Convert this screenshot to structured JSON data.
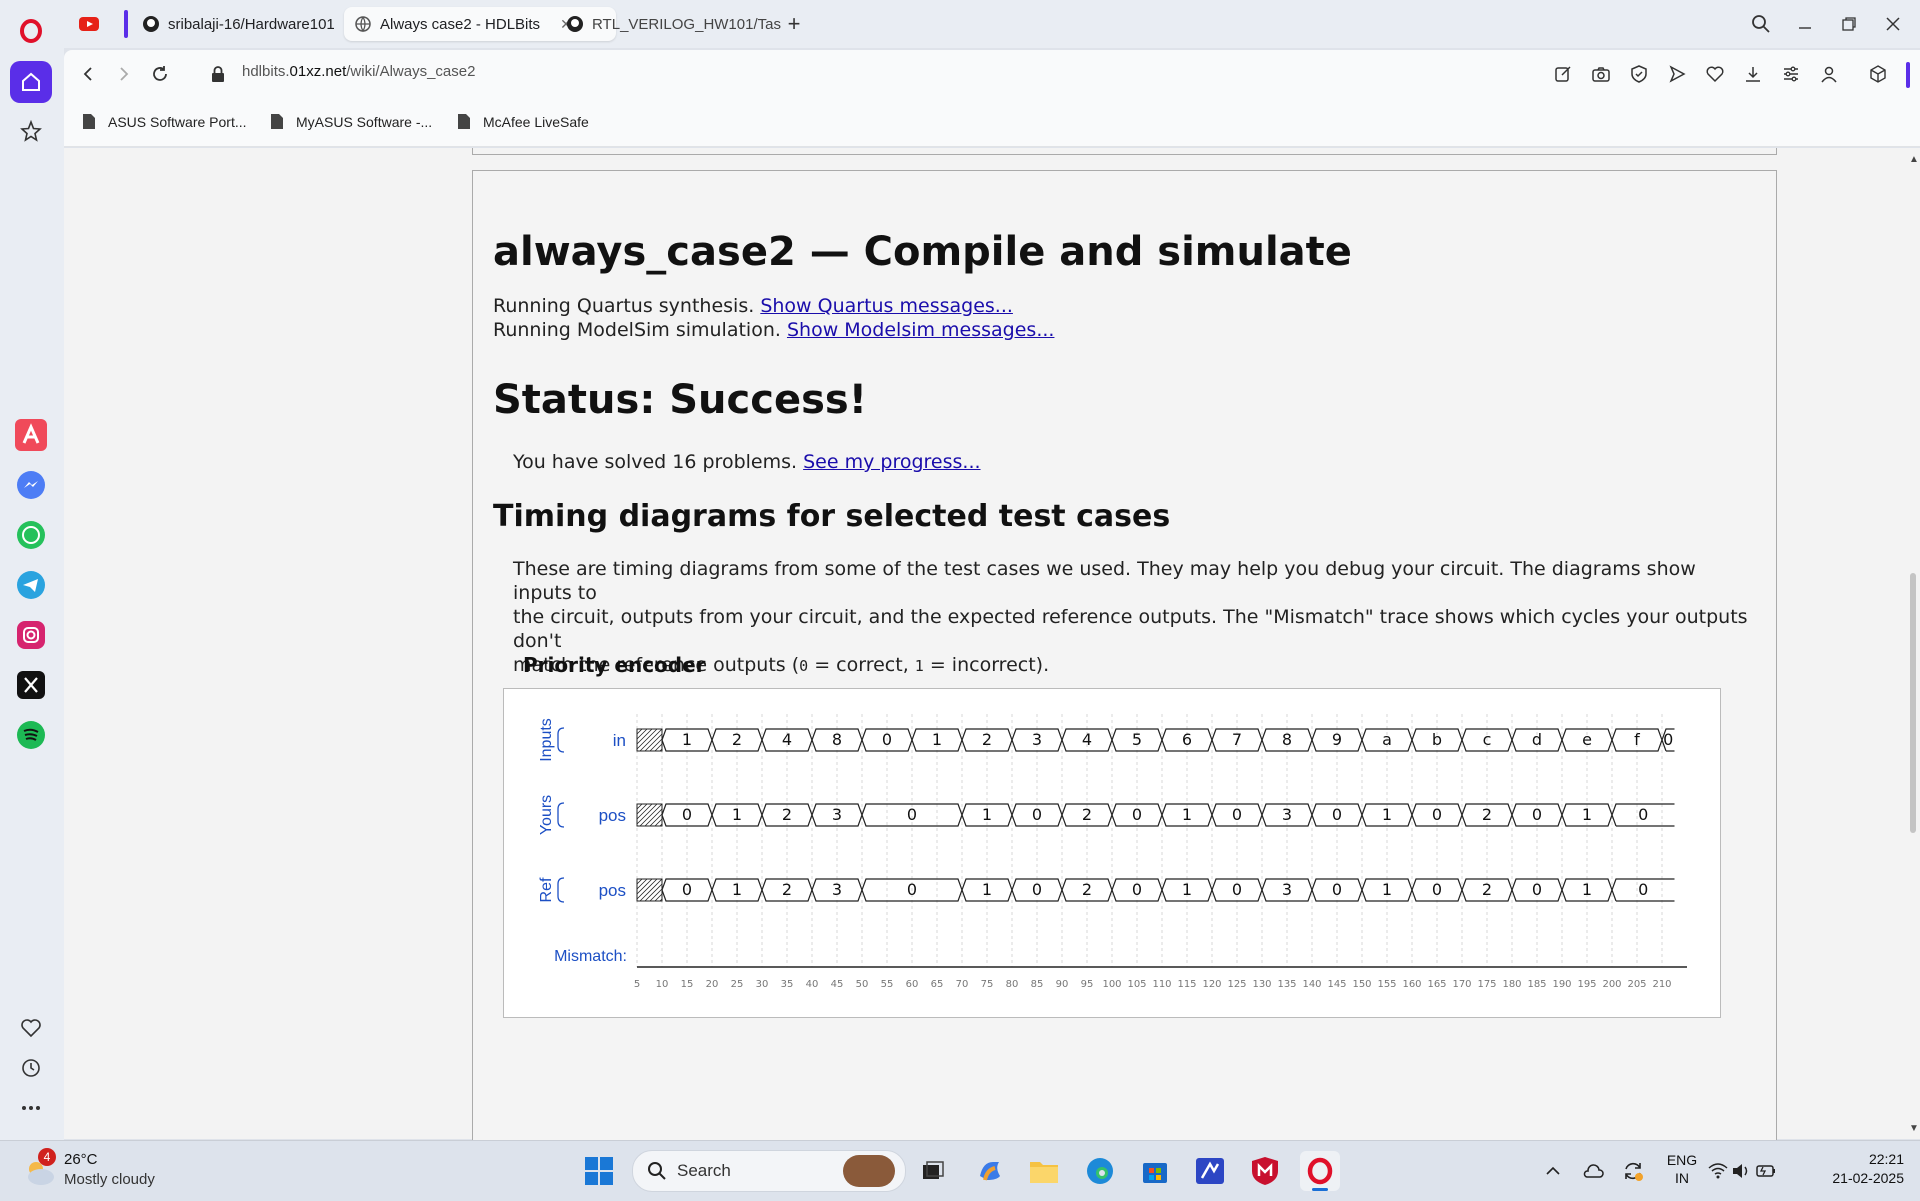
{
  "browser": {
    "tabs": [
      {
        "label": "sribalaji-16/Hardware101",
        "icon": "github-icon"
      },
      {
        "label": "Always case2 - HDLBits",
        "icon": "globe-icon",
        "active": true
      },
      {
        "label": "RTL_VERILOG_HW101/Tas",
        "icon": "github-icon"
      }
    ],
    "url": {
      "prefix": "hdlbits.",
      "domain": "01xz.net",
      "path": "/wiki/Always_case2"
    },
    "bookmarks": [
      "ASUS Software Port...",
      "MyASUS Software -...",
      "McAfee LiveSafe"
    ]
  },
  "page": {
    "title": "always_case2 — Compile and simulate",
    "quartus_text": "Running Quartus synthesis.",
    "quartus_link": "Show Quartus messages...",
    "modelsim_text": "Running ModelSim simulation.",
    "modelsim_link": "Show Modelsim messages...",
    "status": "Status: Success!",
    "solved_text": "You have solved 16 problems.",
    "progress_link": "See my progress...",
    "timing_heading": "Timing diagrams for selected test cases",
    "timing_desc_1": "These are timing diagrams from some of the test cases we used. They may help you debug your circuit. The diagrams show inputs to",
    "timing_desc_2": "the circuit, outputs from your circuit, and the expected reference outputs. The \"Mismatch\" trace shows which cycles your outputs don't",
    "timing_desc_3a": "match the reference outputs (",
    "timing_desc_3b": "0",
    "timing_desc_3c": " = correct, ",
    "timing_desc_3d": "1",
    "timing_desc_3e": " = incorrect).",
    "diagram_title": "Priority encoder"
  },
  "chart_data": {
    "type": "timing",
    "groups": [
      {
        "label": "Inputs",
        "signal": "in",
        "segments": [
          [
            "x",
            1
          ],
          [
            "1",
            2
          ],
          [
            "2",
            2
          ],
          [
            "4",
            2
          ],
          [
            "8",
            2
          ],
          [
            "0",
            2
          ],
          [
            "1",
            2
          ],
          [
            "2",
            2
          ],
          [
            "3",
            2
          ],
          [
            "4",
            2
          ],
          [
            "5",
            2
          ],
          [
            "6",
            2
          ],
          [
            "7",
            2
          ],
          [
            "8",
            2
          ],
          [
            "9",
            2
          ],
          [
            "a",
            2
          ],
          [
            "b",
            2
          ],
          [
            "c",
            2
          ],
          [
            "d",
            2
          ],
          [
            "e",
            2
          ],
          [
            "f",
            2
          ],
          [
            "0",
            0.5
          ]
        ]
      },
      {
        "label": "Yours",
        "signal": "pos",
        "segments": [
          [
            "x",
            1
          ],
          [
            "0",
            2
          ],
          [
            "1",
            2
          ],
          [
            "2",
            2
          ],
          [
            "3",
            2
          ],
          [
            "0",
            4
          ],
          [
            "1",
            2
          ],
          [
            "0",
            2
          ],
          [
            "2",
            2
          ],
          [
            "0",
            2
          ],
          [
            "1",
            2
          ],
          [
            "0",
            2
          ],
          [
            "3",
            2
          ],
          [
            "0",
            2
          ],
          [
            "1",
            2
          ],
          [
            "0",
            2
          ],
          [
            "2",
            2
          ],
          [
            "0",
            2
          ],
          [
            "1",
            2
          ],
          [
            "0",
            2.5
          ]
        ]
      },
      {
        "label": "Ref",
        "signal": "pos",
        "segments": [
          [
            "x",
            1
          ],
          [
            "0",
            2
          ],
          [
            "1",
            2
          ],
          [
            "2",
            2
          ],
          [
            "3",
            2
          ],
          [
            "0",
            4
          ],
          [
            "1",
            2
          ],
          [
            "0",
            2
          ],
          [
            "2",
            2
          ],
          [
            "0",
            2
          ],
          [
            "1",
            2
          ],
          [
            "0",
            2
          ],
          [
            "3",
            2
          ],
          [
            "0",
            2
          ],
          [
            "1",
            2
          ],
          [
            "0",
            2
          ],
          [
            "2",
            2
          ],
          [
            "0",
            2
          ],
          [
            "1",
            2
          ],
          [
            "0",
            2.5
          ]
        ]
      }
    ],
    "mismatch_label": "Mismatch:",
    "mismatch": 0,
    "x_ticks": [
      5,
      10,
      15,
      20,
      25,
      30,
      35,
      40,
      45,
      50,
      55,
      60,
      65,
      70,
      75,
      80,
      85,
      90,
      95,
      100,
      105,
      110,
      115,
      120,
      125,
      130,
      135,
      140,
      145,
      150,
      155,
      160,
      165,
      170,
      175,
      180,
      185,
      190,
      195,
      200,
      205,
      210
    ],
    "x_range": [
      5,
      215
    ]
  },
  "taskbar": {
    "weather_temp": "26°C",
    "weather_desc": "Mostly cloudy",
    "weather_badge": "4",
    "search_placeholder": "Search",
    "lang_1": "ENG",
    "lang_2": "IN",
    "time": "22:21",
    "date": "21-02-2025"
  },
  "colors": {
    "link": "#1a0dab",
    "signal_label": "#1c4fc4",
    "opera_red": "#e0102a",
    "rail_accent": "#5a2ee8"
  }
}
